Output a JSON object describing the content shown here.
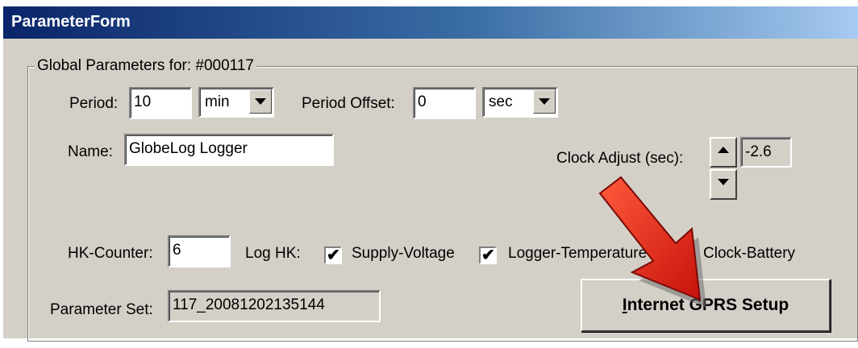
{
  "window": {
    "title": "ParameterForm"
  },
  "group": {
    "label": "Global Parameters for: #000117"
  },
  "period": {
    "label": "Period:",
    "value": "10",
    "unit": "min"
  },
  "period_offset": {
    "label": "Period Offset:",
    "value": "0",
    "unit": "sec"
  },
  "name": {
    "label": "Name:",
    "value": "GlobeLog Logger"
  },
  "clock_adjust": {
    "label": "Clock Adjust (sec):",
    "value": "-2.6"
  },
  "hk_counter": {
    "label": "HK-Counter:",
    "value": "6"
  },
  "log_hk": {
    "label": "Log HK:",
    "options": [
      {
        "label": "Supply-Voltage",
        "checked": true
      },
      {
        "label": "Logger-Temperature",
        "checked": true
      },
      {
        "label": "Clock-Battery",
        "checked": false
      }
    ]
  },
  "parameter_set": {
    "label": "Parameter Set:",
    "value": "117_20081202135144"
  },
  "gprs_button": {
    "mnemonic": "I",
    "rest": "nternet GPRS Setup"
  },
  "annotation": {
    "arrow_color": "#e8271c",
    "icon": "red-arrow-icon"
  },
  "colors": {
    "title_start": "#0a246a",
    "title_end": "#a6caf0",
    "face": "#d4d0c8"
  }
}
